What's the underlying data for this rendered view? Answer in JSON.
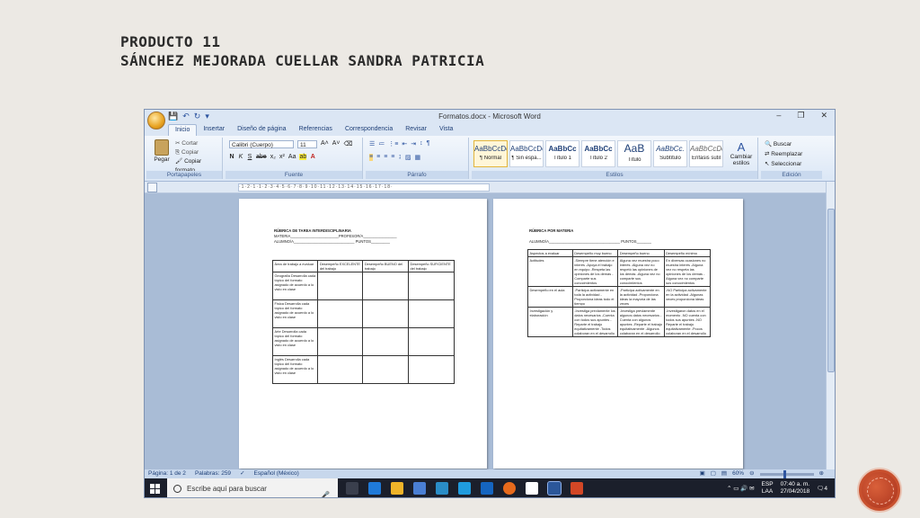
{
  "slide": {
    "title_line1": "PRODUCTO 11",
    "title_line2": "SÁNCHEZ MEJORADA CUELLAR SANDRA PATRICIA"
  },
  "window": {
    "title": "Formatos.docx - Microsoft Word",
    "controls": [
      "–",
      "❐",
      "✕"
    ],
    "qat": [
      "💾",
      "↶",
      "↻",
      "▾"
    ]
  },
  "ribbon": {
    "tabs": [
      "Inicio",
      "Insertar",
      "Diseño de página",
      "Referencias",
      "Correspondencia",
      "Revisar",
      "Vista"
    ],
    "clipboard": {
      "paste": "Pegar",
      "cut": "Cortar",
      "copy": "Copiar",
      "format_painter": "Copiar formato",
      "label": "Portapapeles"
    },
    "font": {
      "name": "Calibri (Cuerpo)",
      "size": "11",
      "label": "Fuente",
      "buttons": [
        "N",
        "K",
        "S",
        "abe",
        "x₂",
        "x²",
        "Aa"
      ]
    },
    "paragraph": {
      "label": "Párrafo"
    },
    "styles": {
      "label": "Estilos",
      "items": [
        {
          "sample": "AaBbCcDc",
          "name": "¶ Normal"
        },
        {
          "sample": "AaBbCcDc",
          "name": "¶ Sin espa..."
        },
        {
          "sample": "AaBbCc",
          "name": "Título 1"
        },
        {
          "sample": "AaBbCc",
          "name": "Título 2"
        },
        {
          "sample": "AaB",
          "name": "Título"
        },
        {
          "sample": "AaBbCc.",
          "name": "Subtítulo"
        },
        {
          "sample": "AaBbCcDc",
          "name": "Énfasis sutil"
        }
      ],
      "change": "Cambiar estilos"
    },
    "editing": {
      "find": "Buscar",
      "replace": "Reemplazar",
      "select": "Seleccionar",
      "label": "Edición"
    }
  },
  "ruler": {
    "scale": "·1·2·1·1·2·3·4·5·6·7·8·9·10·11·12·13·14·15·16·17·18·"
  },
  "page1": {
    "heading": "RÚBRICA DE TAREA INTERDISCIPLINARIA",
    "line1": "MATERIA_______________________PROFESOR/A________________",
    "line2": "ALUMNO/A_____________________________ PUNTOS_________",
    "table": {
      "header": [
        "Área de trabajo a evaluar",
        "Desempeño EXCELENTE del trabajo",
        "Desempeño BUENO del trabajo",
        "Desempeño SUFICIENTE del trabajo"
      ],
      "rows": [
        "Geografía Desarrolla cada tópico del formato asignado de acuerdo a lo visto en clase",
        "Física Desarrolla cada tópico del formato asignado de acuerdo a lo visto en clase",
        "Arte Desarrolla cada tópico del formato asignado de acuerdo a lo visto en clase",
        "Inglés Desarrolla cada tópico del formato asignado de acuerdo a lo visto en clase"
      ]
    }
  },
  "page2": {
    "heading": "RÚBRICA POR MATERIA",
    "line1": "ALUMNO/A__________________________________ PUNTOS_______",
    "table": {
      "header": [
        "Aspectos a evaluar",
        "Desempeño muy bueno",
        "Desempeño bueno",
        "Desempeño mínimo"
      ],
      "rows": [
        [
          "Actitudes",
          "-Siempre tiene atención e interés -Apoya el trabajo en equipo -Respeta las opiniones de los demás -Comparte sus conocimientos",
          "Alguna vez muestra poco interés -Alguna vez no respetó las opiniones de los demás -Alguna vez no comparte sus conocimientos",
          "En diversas ocasiones no muestra interés -Alguna vez no respeta las opiniones de los demás -Alguna vez no comparte sus conocimientos"
        ],
        [
          "Desempeño en el aula",
          "-Participa activamente en toda la actividad -Proporciona ideas todo el tiempo",
          "-Participa activamente en la actividad -Proporciona ideas la mayoría de las veces",
          "-NO Participa activamente en la actividad -Algunas veces proporciona ideas"
        ],
        [
          "Investigación y elaboración",
          "-Investiga previamente los datos necesarios -Cuenta con todos sus apuntes -Reparte el trabajo equitativamente -Todos colaboran en el desarrollo",
          "-Investiga previamente algunos datos necesarios -Cuenta con algunos apuntes -Reparte el trabajo equitativamente -Algunos colaboran en el desarrollo",
          "-Investigaron datos en el momento -NO cuenta con todos sus apuntes -NO Reparte el trabajo equitativamente -Pocos colaboran en el desarrollo"
        ]
      ]
    }
  },
  "statusbar": {
    "page": "Página: 1 de 2",
    "words": "Palabras: 259",
    "lang": "Español (México)",
    "zoom": "60%"
  },
  "taskbar": {
    "search_placeholder": "Escribe aquí para buscar",
    "lang_top": "ESP",
    "lang_bottom": "LAA",
    "time": "07:40 a. m.",
    "date": "27/04/2018",
    "notifications": "4",
    "tray_icons": "⌃ ▭ 🔊 ✉"
  }
}
